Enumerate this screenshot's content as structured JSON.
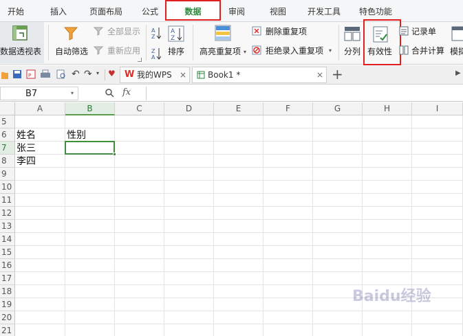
{
  "menu": {
    "tabs": [
      "开始",
      "插入",
      "页面布局",
      "公式",
      "数据",
      "审阅",
      "视图",
      "开发工具",
      "特色功能"
    ],
    "active_tab": "数据"
  },
  "ribbon": {
    "pivot_table": "数据透视表",
    "auto_filter": "自动筛选",
    "show_all": "全部显示",
    "reapply": "重新应用",
    "sort": "排序",
    "highlight_duplicates": "高亮重复项",
    "remove_duplicates": "删除重复项",
    "reject_duplicates": "拒绝录入重复项",
    "split_column": "分列",
    "validity": "有效性",
    "record_form": "记录单",
    "consolidate": "合并计算",
    "simulate": "模拟"
  },
  "doc_tabs": [
    {
      "label": "我的WPS"
    },
    {
      "label": "Book1 *"
    }
  ],
  "formula_bar": {
    "name_box": "B7",
    "fx": "fx",
    "value": ""
  },
  "sheet": {
    "columns": [
      "A",
      "B",
      "C",
      "D",
      "E",
      "F",
      "G",
      "H",
      "I"
    ],
    "selected_column": "B",
    "rows": [
      "5",
      "6",
      "7",
      "8",
      "9",
      "10",
      "11",
      "12",
      "13",
      "14",
      "15",
      "16",
      "17",
      "18",
      "19",
      "20",
      "21"
    ],
    "selected_row": "7",
    "cells": {
      "A6": "姓名",
      "B6": "性别",
      "A7": "张三",
      "A8": "李四"
    },
    "selected_cell": "B7"
  },
  "watermark": "Baidu经验",
  "colors": {
    "accent_green": "#3f8f3a",
    "highlight_red": "#e02020",
    "wps_red": "#d9302a"
  }
}
